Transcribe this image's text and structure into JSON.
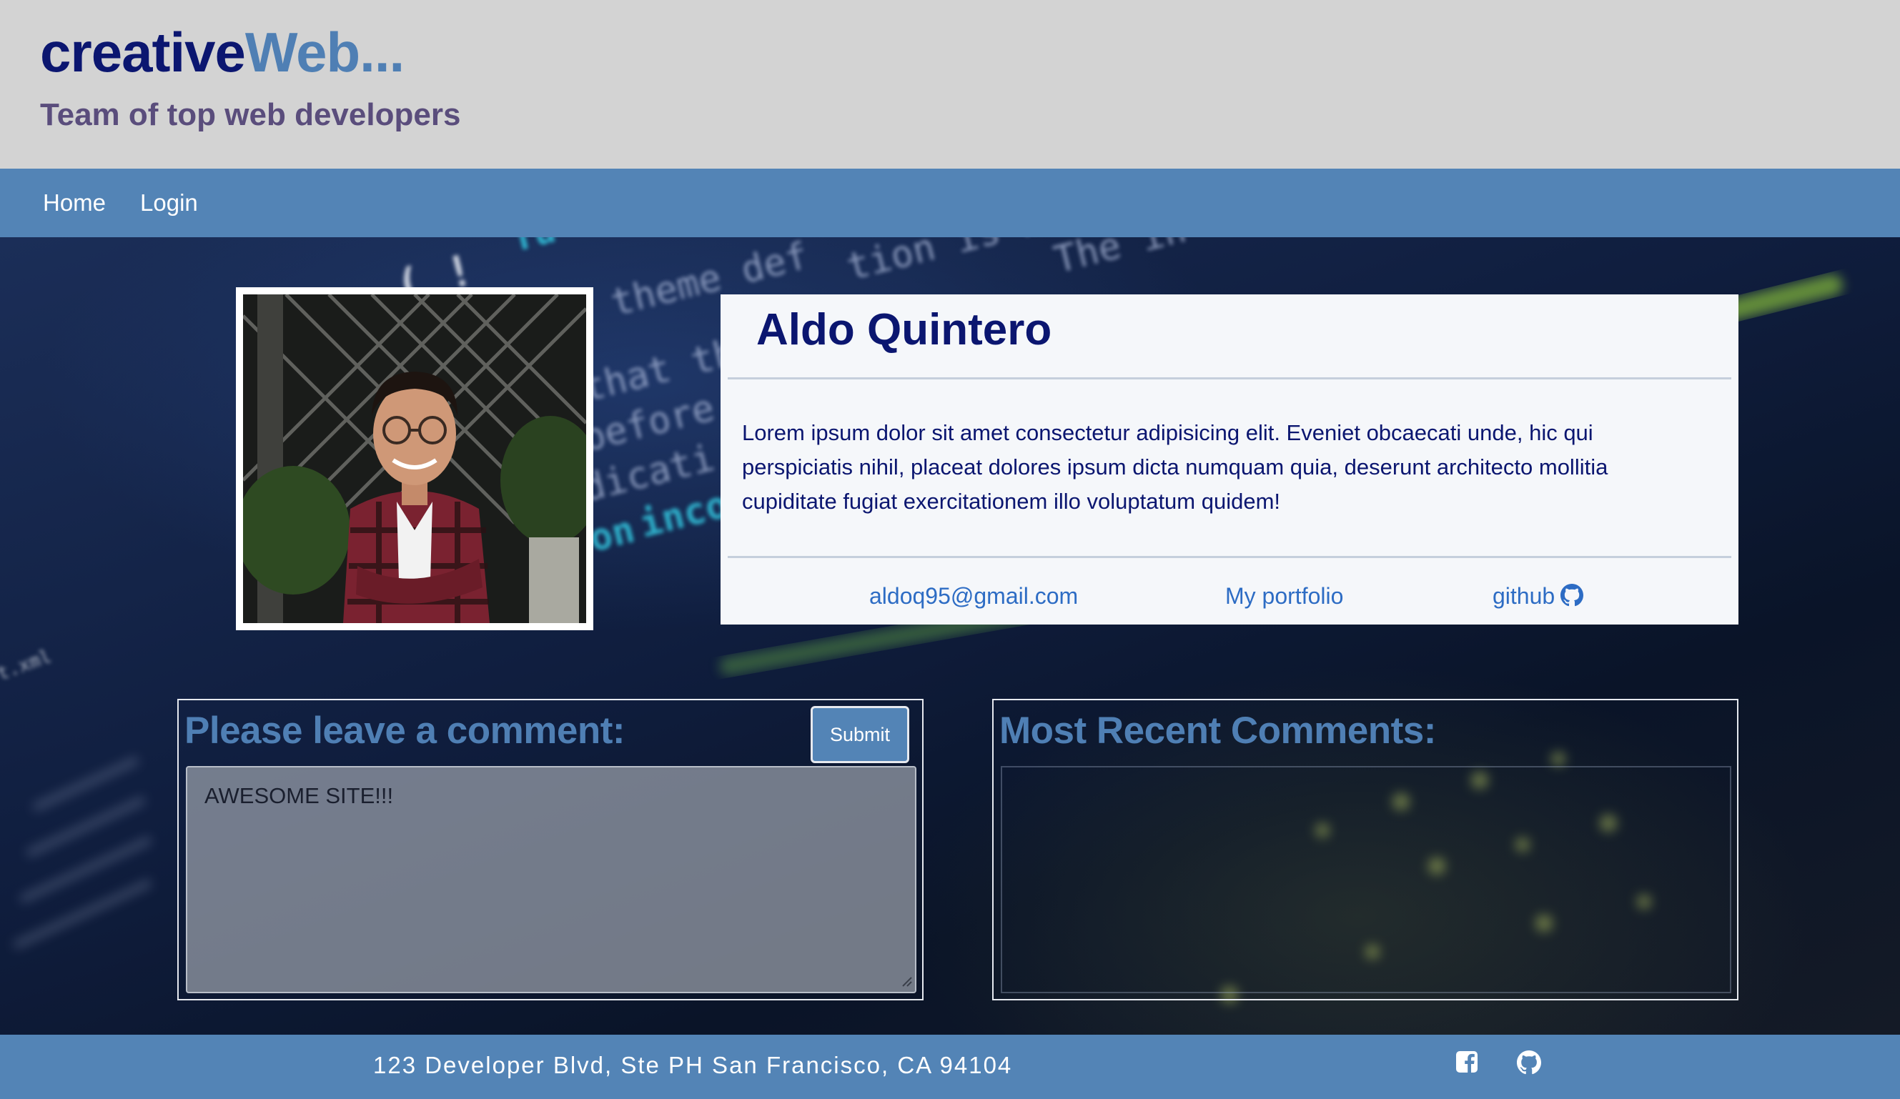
{
  "header": {
    "brand_part1": "creative",
    "brand_part2": "Web...",
    "tagline": "Team of top web developers"
  },
  "nav": {
    "items": [
      {
        "label": "Home"
      },
      {
        "label": "Login"
      }
    ]
  },
  "profile": {
    "name": "Aldo Quintero",
    "bio": "Lorem ipsum dolor sit amet consectetur adipisicing elit. Eveniet obcaecati unde, hic qui perspiciatis nihil, placeat dolores ipsum dicta numquam quia, deserunt architecto mollitia cupiditate fugiat exercitationem illo voluptatum quidem!",
    "email": "aldoq95@gmail.com",
    "portfolio_label": "My portfolio",
    "github_label": "github"
  },
  "comment_form": {
    "title": "Please leave a comment:",
    "submit_label": "Submit",
    "value": "AWESOME SITE!!!"
  },
  "recent_comments": {
    "title": "Most Recent Comments:"
  },
  "footer": {
    "address": "123 Developer Blvd, Ste PH San Francisco, CA 94104"
  },
  "icons": {
    "github": "github-icon",
    "facebook": "facebook-square-icon",
    "resize": "resize-grip-icon"
  },
  "colors": {
    "brand_dark": "#0b1670",
    "brand_accent": "#4f7fb4",
    "nav_bg": "#5384b6",
    "header_bg": "#d3d3d3",
    "link": "#2d6cc4"
  }
}
